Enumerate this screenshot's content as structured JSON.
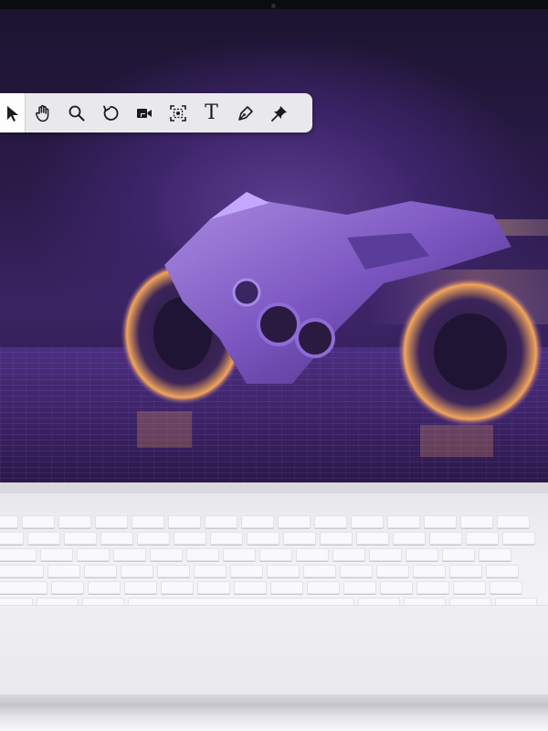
{
  "toolbar": {
    "tools": [
      {
        "name": "select",
        "icon": "pointer-arrow-icon",
        "active": true
      },
      {
        "name": "pan",
        "icon": "hand-icon",
        "active": false
      },
      {
        "name": "zoom",
        "icon": "magnifier-icon",
        "active": false
      },
      {
        "name": "rotate",
        "icon": "rotate-icon",
        "active": false
      },
      {
        "name": "record",
        "icon": "video-camera-icon",
        "active": false
      },
      {
        "name": "capture-area",
        "icon": "capture-area-icon",
        "active": false
      },
      {
        "name": "text",
        "icon": "text-icon",
        "glyph": "T",
        "active": false
      },
      {
        "name": "pen",
        "icon": "pen-icon",
        "active": false
      },
      {
        "name": "pin",
        "icon": "pin-icon",
        "active": false
      }
    ]
  },
  "wallpaper": {
    "subject": "motorcycle-art",
    "colors": {
      "primary": "#4b2e7e",
      "accent": "#f09a4a"
    }
  }
}
